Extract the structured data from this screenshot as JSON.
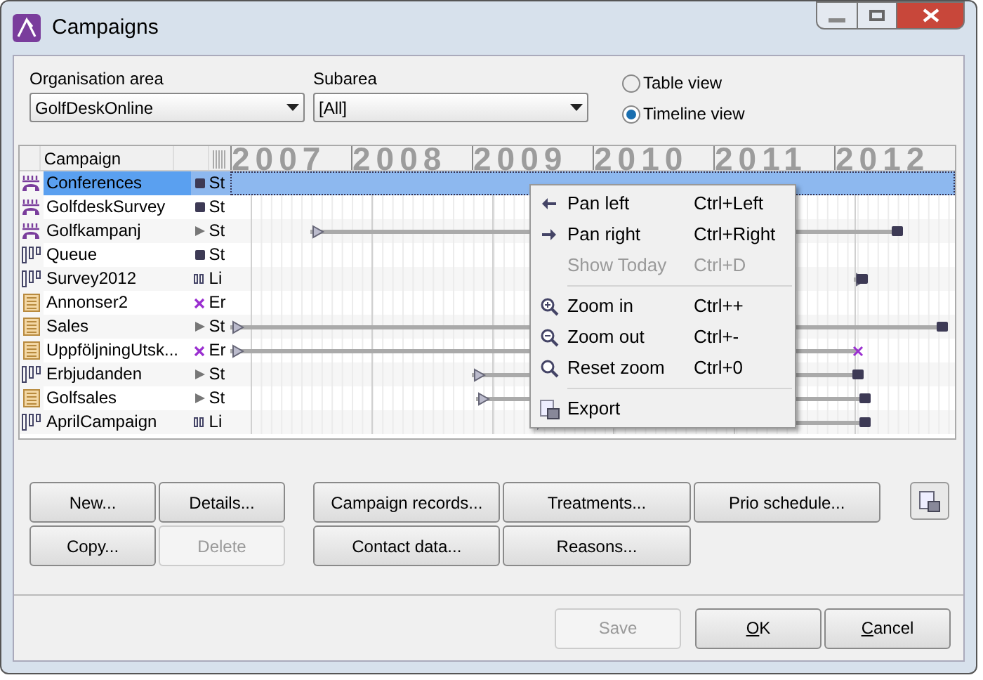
{
  "window": {
    "title": "Campaigns"
  },
  "filters": [
    {
      "label": "Organisation area",
      "value": "GolfDeskOnline"
    },
    {
      "label": "Subarea",
      "value": "[All]"
    }
  ],
  "view_options": [
    {
      "label": "Table view",
      "selected": false
    },
    {
      "label": "Timeline view",
      "selected": true
    }
  ],
  "table": {
    "columns": [
      "Campaign"
    ],
    "years": [
      "2007",
      "2008",
      "2009",
      "2010",
      "2011",
      "2012"
    ],
    "rows": [
      {
        "kind": "phone",
        "name": "Conferences",
        "status": {
          "kind": "stopped",
          "text": "St"
        },
        "selected": true
      },
      {
        "kind": "phone",
        "name": "GolfdeskSurvey",
        "status": {
          "kind": "stopped",
          "text": "St"
        },
        "selected": false
      },
      {
        "kind": "phone",
        "name": "Golfkampanj",
        "status": {
          "kind": "started",
          "text": "St"
        },
        "selected": false
      },
      {
        "kind": "queue",
        "name": "Queue",
        "status": {
          "kind": "stopped",
          "text": "St"
        },
        "selected": false
      },
      {
        "kind": "queue",
        "name": "Survey2012",
        "status": {
          "kind": "limited",
          "text": "Li"
        },
        "selected": false
      },
      {
        "kind": "list",
        "name": "Annonser2",
        "status": {
          "kind": "ended",
          "text": "Er"
        },
        "selected": false
      },
      {
        "kind": "list",
        "name": "Sales",
        "status": {
          "kind": "started",
          "text": "St"
        },
        "selected": false
      },
      {
        "kind": "list",
        "name": "UppföljningUtsk...",
        "status": {
          "kind": "ended",
          "text": "Er"
        },
        "selected": false
      },
      {
        "kind": "queue",
        "name": "Erbjudanden",
        "status": {
          "kind": "started",
          "text": "St"
        },
        "selected": false
      },
      {
        "kind": "list",
        "name": "Golfsales",
        "status": {
          "kind": "started",
          "text": "St"
        },
        "selected": false
      },
      {
        "kind": "queue",
        "name": "AprilCampaign",
        "status": {
          "kind": "limited",
          "text": "Li"
        },
        "selected": false
      }
    ]
  },
  "context_menu": [
    {
      "kind": "item",
      "label": "Pan left",
      "shortcut": "Ctrl+Left",
      "disabled": false
    },
    {
      "kind": "item",
      "label": "Pan right",
      "shortcut": "Ctrl+Right",
      "disabled": false
    },
    {
      "kind": "item",
      "label": "Show Today",
      "shortcut": "Ctrl+D",
      "disabled": true
    },
    {
      "kind": "separator"
    },
    {
      "kind": "item",
      "label": "Zoom in",
      "shortcut": "Ctrl++",
      "disabled": false
    },
    {
      "kind": "item",
      "label": "Zoom out",
      "shortcut": "Ctrl+-",
      "disabled": false
    },
    {
      "kind": "item",
      "label": "Reset zoom",
      "shortcut": "Ctrl+0",
      "disabled": false
    },
    {
      "kind": "separator"
    },
    {
      "kind": "item",
      "label": "Export",
      "disabled": false
    }
  ],
  "left_buttons": [
    {
      "label": "New...",
      "disabled": false
    },
    {
      "label": "Details...",
      "disabled": false
    },
    {
      "label": "Copy...",
      "disabled": false
    },
    {
      "label": "Delete",
      "disabled": true
    }
  ],
  "middle_buttons": [
    {
      "label": "Campaign records...",
      "disabled": false
    },
    {
      "label": "Treatments...",
      "disabled": false
    },
    {
      "label": "Prio schedule...",
      "disabled": false
    },
    {
      "label": "Contact data...",
      "disabled": false
    },
    {
      "label": "Reasons...",
      "disabled": false
    }
  ],
  "footer_buttons": [
    {
      "label": "Save",
      "disabled": true,
      "mnemonic": false
    },
    {
      "label": "OK",
      "disabled": false,
      "mnemonic": true
    },
    {
      "label": "Cancel",
      "disabled": false,
      "mnemonic": true
    }
  ]
}
